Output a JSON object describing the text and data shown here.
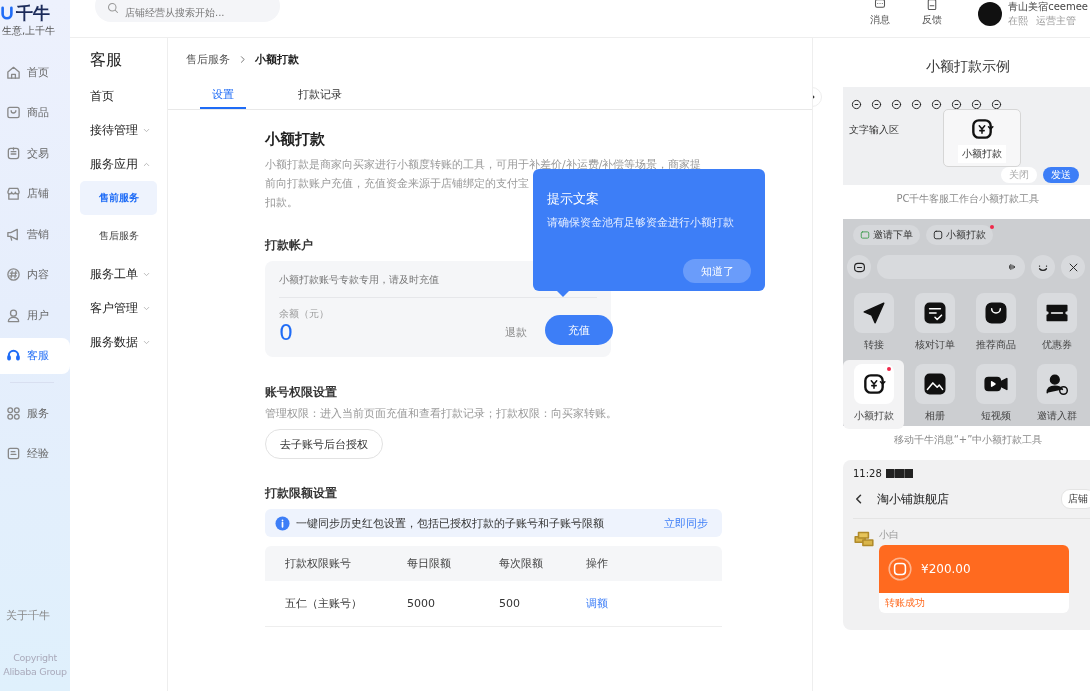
{
  "rail": {
    "logo": "千牛",
    "slogan": "生意,上千牛",
    "items": [
      {
        "label": "首页",
        "selected": false
      },
      {
        "label": "商品",
        "selected": false
      },
      {
        "label": "交易",
        "selected": false
      },
      {
        "label": "店铺",
        "selected": false
      },
      {
        "label": "营销",
        "selected": false
      },
      {
        "label": "内容",
        "selected": false
      },
      {
        "label": "用户",
        "selected": false
      },
      {
        "label": "客服",
        "selected": true
      }
    ],
    "items2": [
      {
        "label": "服务",
        "selected": false
      },
      {
        "label": "经验",
        "selected": false
      }
    ],
    "about": "关于千牛",
    "copyright": [
      "Copyright",
      "Alibaba Group"
    ]
  },
  "header": {
    "search": {
      "placeholder": "店铺经营从搜索开始..."
    },
    "actions": [
      "消息",
      "反馈"
    ],
    "user": {
      "name": "青山美宿ceemee",
      "status": "在熙",
      "role": "运营主管"
    }
  },
  "sidebar": {
    "title": "客服",
    "items": [
      {
        "label": "首页",
        "kind": "link"
      },
      {
        "label": "接待管理",
        "kind": "group",
        "expanded": false
      },
      {
        "label": "服务应用",
        "kind": "group",
        "expanded": true,
        "children": [
          {
            "label": "售前服务",
            "selected": true
          },
          {
            "label": "售后服务",
            "selected": false
          }
        ]
      },
      {
        "label": "服务工单",
        "kind": "group",
        "expanded": false
      },
      {
        "label": "客户管理",
        "kind": "group",
        "expanded": false
      },
      {
        "label": "服务数据",
        "kind": "group",
        "expanded": false
      }
    ]
  },
  "breadcrumb": [
    "售后服务",
    "小额打款"
  ],
  "tabs": [
    {
      "label": "设置",
      "selected": true
    },
    {
      "label": "打款记录",
      "selected": false
    }
  ],
  "main": {
    "title": "小额打款",
    "description_lines": [
      "小额打款是商家向买家进行小额度转账的工具，可用于补差价/补运费/补偿等场景，商家提",
      "前向打款账户充值，充值资金来源于店铺绑定的支付宝",
      "扣款。"
    ],
    "account": {
      "heading": "打款帐户",
      "note": "小额打款账号专款专用，请及时充值",
      "balance_label": "余额（元）",
      "balance": "0",
      "refund": "退款",
      "recharge": "充值"
    },
    "permissions": {
      "heading": "账号权限设置",
      "description": "管理权限：进入当前页面充值和查看打款记录；打款权限：向买家转账。",
      "button": "去子账号后台授权"
    },
    "limits": {
      "heading": "打款限额设置",
      "banner": "一键同步历史红包设置，包括已授权打款的子账号和子账号限额",
      "sync": "立即同步",
      "columns": [
        "打款权限账号",
        "每日限额",
        "每次限额",
        "操作"
      ],
      "rows": [
        {
          "account": "五仁（主账号）",
          "daily": "5000",
          "per": "500",
          "action": "调额"
        }
      ]
    }
  },
  "tooltip": {
    "title": "提示文案",
    "body": "请确保资金池有足够资金进行小额打款",
    "button": "知道了"
  },
  "examples": {
    "title": "小额打款示例",
    "pc": {
      "input_hint": "文字输入区",
      "popup": "小额打款",
      "close": "关闭",
      "send": "发送",
      "caption": "PC千牛客服工作台小额打款工具"
    },
    "mobile": {
      "chips": [
        "邀请下单",
        "小额打款"
      ],
      "tiles": [
        {
          "label": "转接",
          "selected": false
        },
        {
          "label": "核对订单",
          "selected": false
        },
        {
          "label": "推荐商品",
          "selected": false
        },
        {
          "label": "优惠券",
          "selected": false
        },
        {
          "label": "小额打款",
          "selected": true
        },
        {
          "label": "相册",
          "selected": false
        },
        {
          "label": "短视频",
          "selected": false
        },
        {
          "label": "邀请入群",
          "selected": false
        }
      ],
      "caption": "移动千牛消息“+”中小额打款工具"
    },
    "chat": {
      "time": "11:28",
      "shop": "淘小铺旗舰店",
      "shop_button": "店铺",
      "sender": "小白",
      "amount": "¥200.00",
      "result": "转账成功"
    }
  }
}
